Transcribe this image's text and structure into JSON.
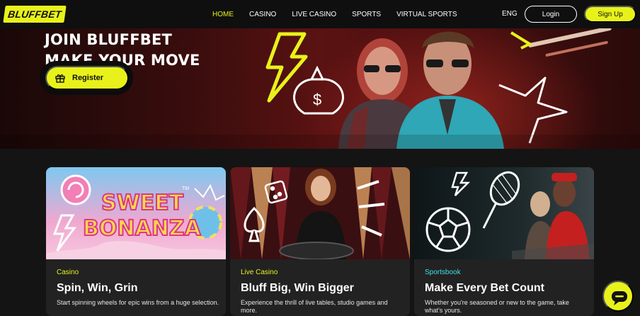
{
  "brand": {
    "logo_text": "BLUFFBET"
  },
  "nav": {
    "items": [
      {
        "label": "HOME",
        "active": true
      },
      {
        "label": "CASINO",
        "active": false
      },
      {
        "label": "LIVE CASINO",
        "active": false
      },
      {
        "label": "SPORTS",
        "active": false
      },
      {
        "label": "VIRTUAL SPORTS",
        "active": false
      }
    ],
    "language": "ENG",
    "login_label": "Login",
    "signup_label": "Sign Up"
  },
  "hero": {
    "title_line1": "JOIN BLUFFBET",
    "title_line2": "MAKE YOUR MOVE",
    "register_label": "Register"
  },
  "cards": [
    {
      "category": "Casino",
      "title": "Spin, Win, Grin",
      "description": "Start spinning wheels for epic wins from a huge selection.",
      "image_text_1": "SWEET",
      "image_text_2": "BONANZA",
      "image_tm": "TM"
    },
    {
      "category": "Live Casino",
      "title": "Bluff Big, Win Bigger",
      "description": "Experience the thrill of live tables, studio games and more."
    },
    {
      "category": "Sportsbook",
      "title": "Make Every Bet Count",
      "description": "Whether you're seasoned or new to the game, take what's yours."
    }
  ],
  "colors": {
    "accent": "#e8f21a",
    "cyan": "#3ee0e6",
    "background": "#141414",
    "card": "#222222"
  },
  "icons": [
    "gift-icon",
    "chat-icon",
    "lightning-icon",
    "money-bag-icon",
    "spade-icon",
    "dice-icon",
    "soccer-ball-icon",
    "tennis-racket-icon"
  ]
}
